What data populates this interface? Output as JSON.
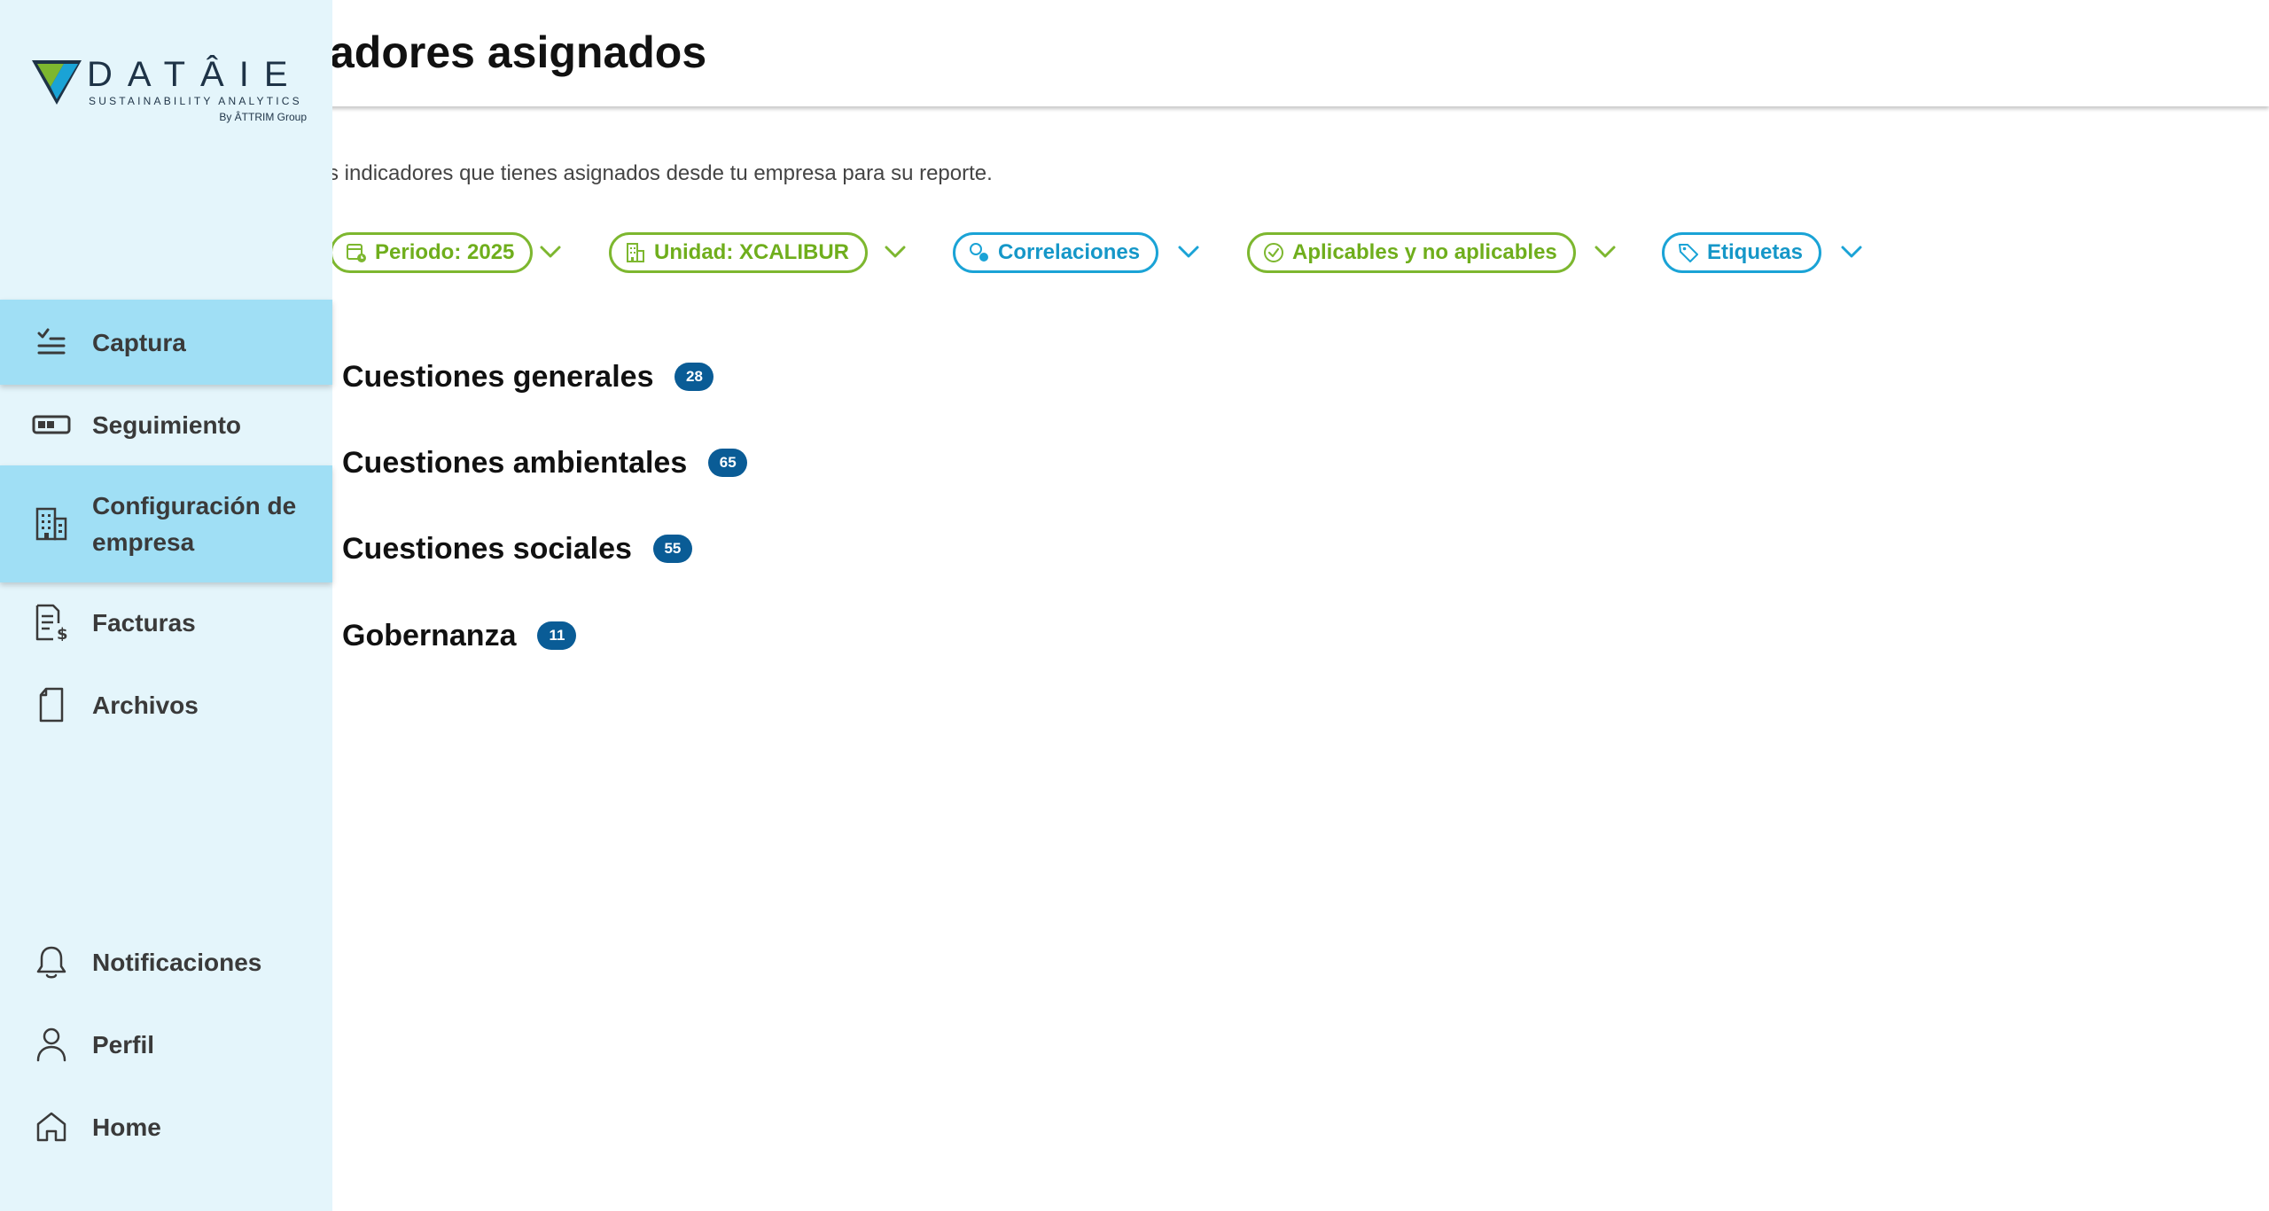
{
  "header": {
    "title": "adores asignados"
  },
  "intro": "s indicadores que tienes asignados desde tu empresa para su reporte.",
  "filters": [
    {
      "label": "Periodo: 2025",
      "icon": "calendar-clock-icon"
    },
    {
      "label": "Unidad: XCALIBUR",
      "icon": "building-icon"
    },
    {
      "label": "Correlaciones",
      "icon": "correlation-icon"
    },
    {
      "label": "Aplicables y no aplicables",
      "icon": "check-circle-icon"
    },
    {
      "label": "Etiquetas",
      "icon": "tag-icon"
    }
  ],
  "sections": [
    {
      "title": "Cuestiones generales",
      "count": "28"
    },
    {
      "title": "Cuestiones ambientales",
      "count": "65"
    },
    {
      "title": "Cuestiones sociales",
      "count": "55"
    },
    {
      "title": "Gobernanza",
      "count": "11"
    }
  ],
  "logo": {
    "word": "DATÂIE",
    "subtitle": "SUSTAINABILITY ANALYTICS",
    "by": "By ÂTTRIM Group"
  },
  "sidebar": {
    "items": [
      {
        "label": "Captura",
        "icon": "checklist-icon"
      },
      {
        "label": "Seguimiento",
        "icon": "progress-bar-icon"
      },
      {
        "label": "Configuración de empresa",
        "icon": "building-icon"
      },
      {
        "label": "Facturas",
        "icon": "invoice-icon"
      },
      {
        "label": "Archivos",
        "icon": "file-icon"
      }
    ],
    "bottom": [
      {
        "label": "Notificaciones",
        "icon": "bell-icon"
      },
      {
        "label": "Perfil",
        "icon": "user-icon"
      },
      {
        "label": "Home",
        "icon": "home-icon"
      }
    ]
  },
  "colors": {
    "sidebar_bg": "#e4f5fb",
    "sidebar_active": "#a0dff5",
    "chip_green": "#7db72f",
    "chip_blue": "#1aa3d6",
    "badge": "#0a5c96"
  }
}
